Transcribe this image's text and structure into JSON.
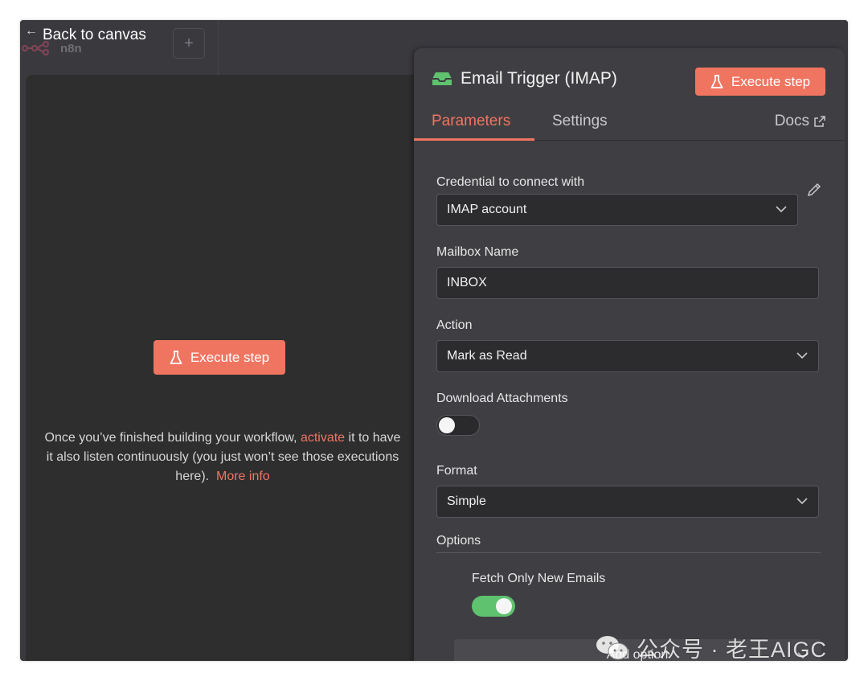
{
  "topbar": {
    "back_label": "Back to canvas",
    "logo_text": "n8n",
    "add_symbol": "+"
  },
  "canvas": {
    "execute_label": "Execute step",
    "message_before": "Once you’ve finished building your workflow, ",
    "activate_link": "activate",
    "message_after": " it to have it also listen continuously (you just won’t see those executions here).  ",
    "more_info_link": "More info"
  },
  "node": {
    "title": "Email Trigger (IMAP)",
    "icon": "inbox-icon",
    "execute_label": "Execute step",
    "tabs": [
      {
        "label": "Parameters",
        "active": true
      },
      {
        "label": "Settings",
        "active": false
      }
    ],
    "docs_label": "Docs"
  },
  "parameters": {
    "credential": {
      "label": "Credential to connect with",
      "value": "IMAP account"
    },
    "mailbox": {
      "label": "Mailbox Name",
      "value": "INBOX"
    },
    "action": {
      "label": "Action",
      "value": "Mark as Read"
    },
    "download_attachments": {
      "label": "Download Attachments",
      "enabled": false
    },
    "format": {
      "label": "Format",
      "value": "Simple"
    },
    "options": {
      "label": "Options",
      "fetch_only_new": {
        "label": "Fetch Only New Emails",
        "enabled": true
      },
      "add_option_label": "Add option"
    }
  },
  "watermark": {
    "text": "公众号 · 老王AIGC"
  },
  "colors": {
    "accent": "#f07561",
    "toggle_on": "#5fc26f",
    "node_icon": "#5fc26f",
    "panel_bg": "#3f3f43",
    "canvas_bg": "#2e2e2e"
  }
}
